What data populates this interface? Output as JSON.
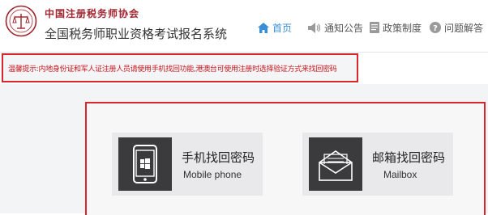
{
  "header": {
    "org_name": "中国注册税务师协会",
    "system_title": "全国税务师职业资格考试报名系统"
  },
  "nav": {
    "items": [
      {
        "label": "首页",
        "icon": "home-icon",
        "active": true
      },
      {
        "label": "通知公告",
        "icon": "speaker-icon",
        "active": false
      },
      {
        "label": "政策制度",
        "icon": "document-icon",
        "active": false
      },
      {
        "label": "问题解答",
        "icon": "question-icon",
        "active": false
      }
    ]
  },
  "notice": {
    "text": "温馨提示:内地身份证和军人证注册人员请使用手机找回功能,港澳台可使用注册时选择验证方式来找回密码"
  },
  "options": [
    {
      "title": "手机找回密码",
      "subtitle": "Mobile phone",
      "icon": "smartphone-icon"
    },
    {
      "title": "邮箱找回密码",
      "subtitle": "Mailbox",
      "icon": "envelope-icon"
    }
  ],
  "colors": {
    "accent_blue": "#3a8ed6",
    "alert_red": "#d9262c",
    "brand_red": "#a0242d",
    "icon_bg": "#3b3b3d",
    "card_bg": "#e9e9eb"
  }
}
